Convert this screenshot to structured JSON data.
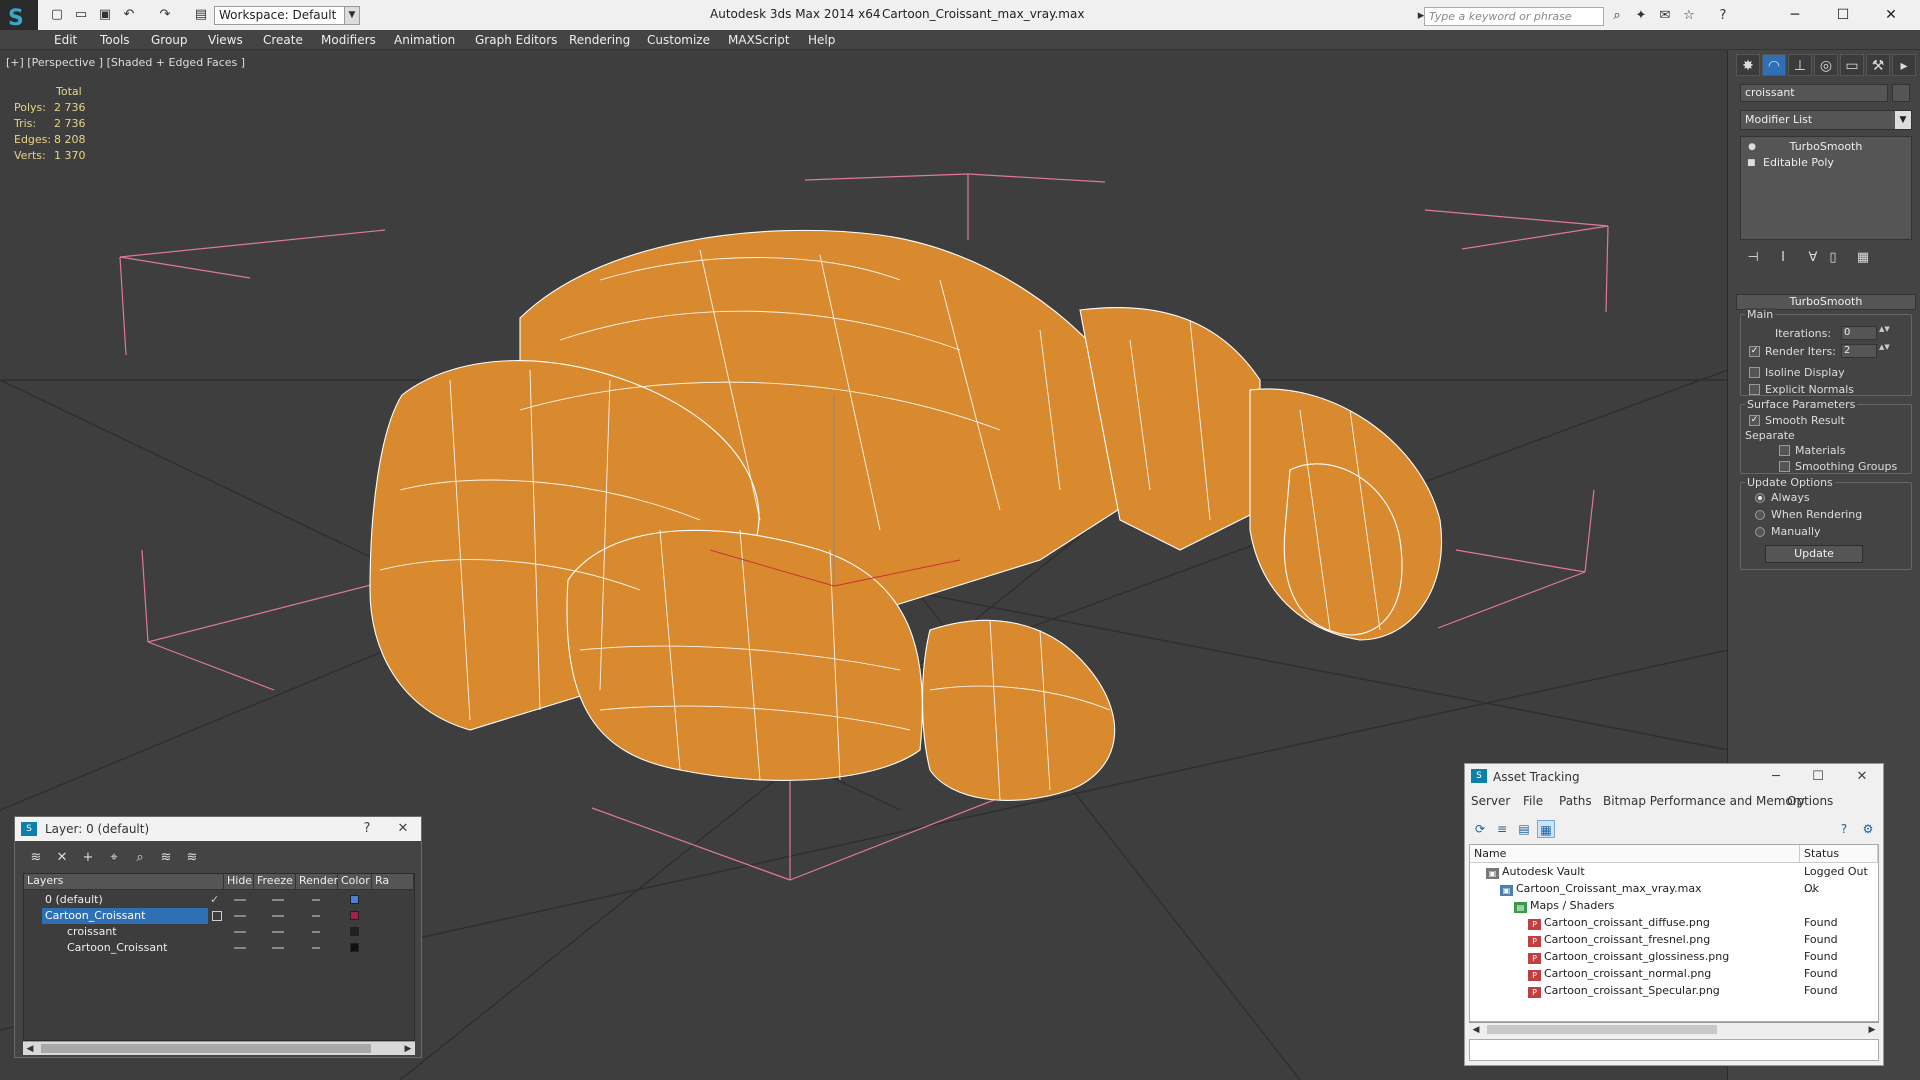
{
  "titlebar": {
    "workspace": "Workspace: Default",
    "app_title": "Autodesk 3ds Max  2014 x64",
    "file_title": "Cartoon_Croissant_max_vray.max",
    "search_placeholder": "Type a keyword or phrase"
  },
  "menu": [
    "Edit",
    "Tools",
    "Group",
    "Views",
    "Create",
    "Modifiers",
    "Animation",
    "Graph Editors",
    "Rendering",
    "Customize",
    "MAXScript",
    "Help"
  ],
  "viewport": {
    "label": "[+] [Perspective ] [Shaded + Edged Faces ]",
    "stats": {
      "header": "Total",
      "rows": [
        {
          "k": "Polys:",
          "v": "2 736"
        },
        {
          "k": "Tris:",
          "v": "2 736"
        },
        {
          "k": "Edges:",
          "v": "8 208"
        },
        {
          "k": "Verts:",
          "v": "1 370"
        }
      ]
    },
    "colors": {
      "object": "#d98a2e",
      "wire": "#ffffff",
      "grid": "#323232",
      "bbox": "#e0789b"
    }
  },
  "command_panel": {
    "object_name": "croissant",
    "modifier_list": "Modifier List",
    "stack": [
      "TurboSmooth",
      "Editable Poly"
    ],
    "turbosmooth": {
      "title": "TurboSmooth",
      "main": "Main",
      "iterations_label": "Iterations:",
      "iterations": "0",
      "render_iters_label": "Render Iters:",
      "render_iters": "2",
      "isoline": "Isoline Display",
      "explicit_normals": "Explicit Normals",
      "surface_params": "Surface Parameters",
      "smooth_result": "Smooth Result",
      "separate": "Separate",
      "materials": "Materials",
      "smoothing_groups": "Smoothing Groups",
      "update_options": "Update Options",
      "always": "Always",
      "when_rendering": "When Rendering",
      "manually": "Manually",
      "update": "Update"
    }
  },
  "layer_window": {
    "title": "Layer: 0 (default)",
    "columns": [
      "Layers",
      "Hide",
      "Freeze",
      "Render",
      "Color",
      "Ra"
    ],
    "rows": [
      {
        "name": "0 (default)",
        "color": "#4a7fd4"
      },
      {
        "name": "Cartoon_Croissant",
        "color": "#a0204a"
      },
      {
        "name": "croissant",
        "color": "#202020"
      },
      {
        "name": "Cartoon_Croissant",
        "color": "#101010"
      }
    ]
  },
  "asset_tracking": {
    "title": "Asset Tracking",
    "menu": [
      "Server",
      "File",
      "Paths",
      "Bitmap Performance and Memory",
      "Options"
    ],
    "columns": [
      "Name",
      "Status"
    ],
    "rows": [
      {
        "name": "Autodesk Vault",
        "status": "Logged Out ..."
      },
      {
        "name": "Cartoon_Croissant_max_vray.max",
        "status": "Ok"
      },
      {
        "name": "Maps / Shaders",
        "status": ""
      },
      {
        "name": "Cartoon_croissant_diffuse.png",
        "status": "Found"
      },
      {
        "name": "Cartoon_croissant_fresnel.png",
        "status": "Found"
      },
      {
        "name": "Cartoon_croissant_glossiness.png",
        "status": "Found"
      },
      {
        "name": "Cartoon_croissant_normal.png",
        "status": "Found"
      },
      {
        "name": "Cartoon_croissant_Specular.png",
        "status": "Found"
      }
    ]
  }
}
